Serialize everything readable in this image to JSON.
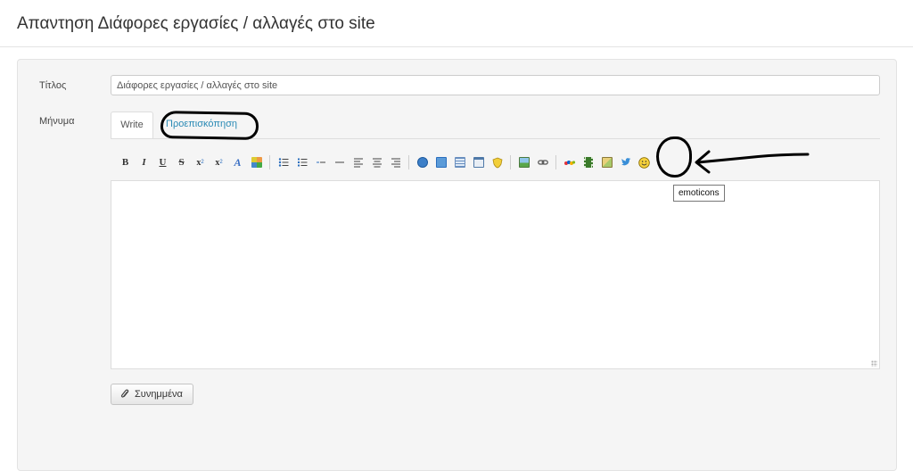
{
  "page": {
    "title": "Απαντηση Διάφορες εργασίες / αλλαγές στο site"
  },
  "form": {
    "title_label": "Τίτλος",
    "title_value": "Διάφορες εργασίες / αλλαγές στο site",
    "message_label": "Μήνυμα"
  },
  "tabs": {
    "write": "Write",
    "preview": "Προεπισκόπηση"
  },
  "toolbar": {
    "bold": "B",
    "italic": "I",
    "underline": "U",
    "strike": "S",
    "subscript": "x",
    "superscript": "x",
    "font_color": "A"
  },
  "editor": {
    "value": ""
  },
  "tooltip": {
    "text": "emoticons"
  },
  "attachments": {
    "label": "Συνημμένα"
  },
  "colors": {
    "link": "#2a8ab5",
    "panel_bg": "#f5f5f5",
    "annotation": "#000000"
  }
}
